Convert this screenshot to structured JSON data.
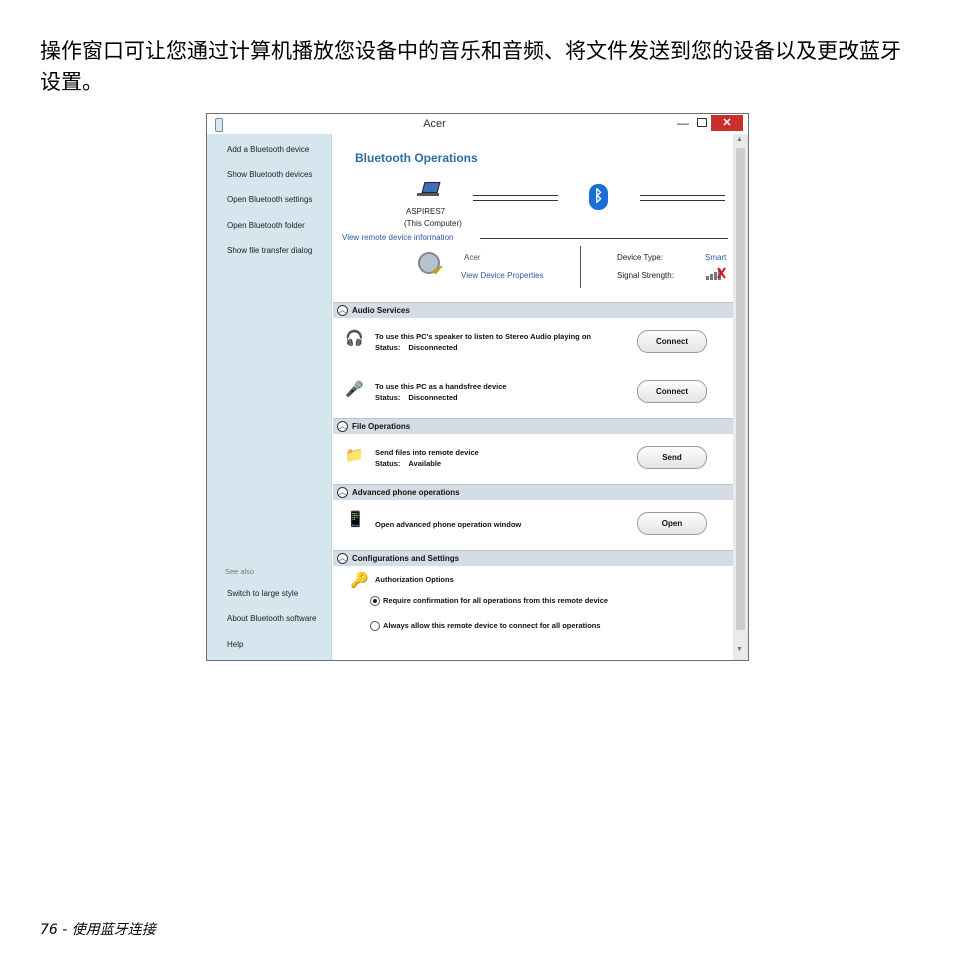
{
  "intro": "操作窗口可让您通过计算机播放您设备中的音乐和音频、将文件发送到您的设备以及更改蓝牙设置。",
  "footer": "76 - 使用蓝牙连接",
  "window": {
    "title": "Acer",
    "min_glyph": "—",
    "close_glyph": "✕"
  },
  "sidebar": {
    "items": [
      "Add a Bluetooth device",
      "Show Bluetooth devices",
      "Open Bluetooth settings",
      "Open Bluetooth folder",
      "Show file transfer dialog"
    ],
    "see_also_label": "See also",
    "see_also_items": [
      "Switch to large style",
      "About Bluetooth software",
      "Help"
    ]
  },
  "ops": {
    "title": "Bluetooth Operations",
    "computer_name": "ASPIRES7",
    "computer_sub": "(This Computer)",
    "view_remote": "View remote device information",
    "remote_name": "Acer",
    "view_props": "View Device Properties",
    "device_type_label": "Device Type:",
    "device_type_value": "Smart",
    "signal_label": "Signal Strength:"
  },
  "sections": {
    "audio": "Audio Services",
    "file": "File Operations",
    "phone": "Advanced phone operations",
    "config": "Configurations and Settings"
  },
  "rows": {
    "stereo_title": "To use this PC's speaker to listen to Stereo Audio playing on",
    "status_label": "Status:",
    "stereo_status": "Disconnected",
    "handsfree_title": "To use this PC as a handsfree device",
    "handsfree_status": "Disconnected",
    "send_title": "Send files into remote device",
    "send_status": "Available",
    "phone_title": "Open advanced phone operation window",
    "auth_title": "Authorization Options",
    "radio1": "Require confirmation for all operations from this remote device",
    "radio2": "Always allow this remote device to connect for all operations"
  },
  "buttons": {
    "connect": "Connect",
    "send": "Send",
    "open": "Open"
  },
  "icons": [
    "bluetooth-window-icon",
    "laptop-icon",
    "bluetooth-icon",
    "acer-device-icon",
    "signal-icon",
    "headphones-icon",
    "headset-icon",
    "folder-send-icon",
    "phone-icon",
    "keys-icon"
  ],
  "colors": {
    "accent": "#2b6f9e",
    "link": "#2c5aa0",
    "sidebar": "#d6e6ef",
    "close": "#c7302c",
    "bluetooth": "#1b6fd4"
  }
}
